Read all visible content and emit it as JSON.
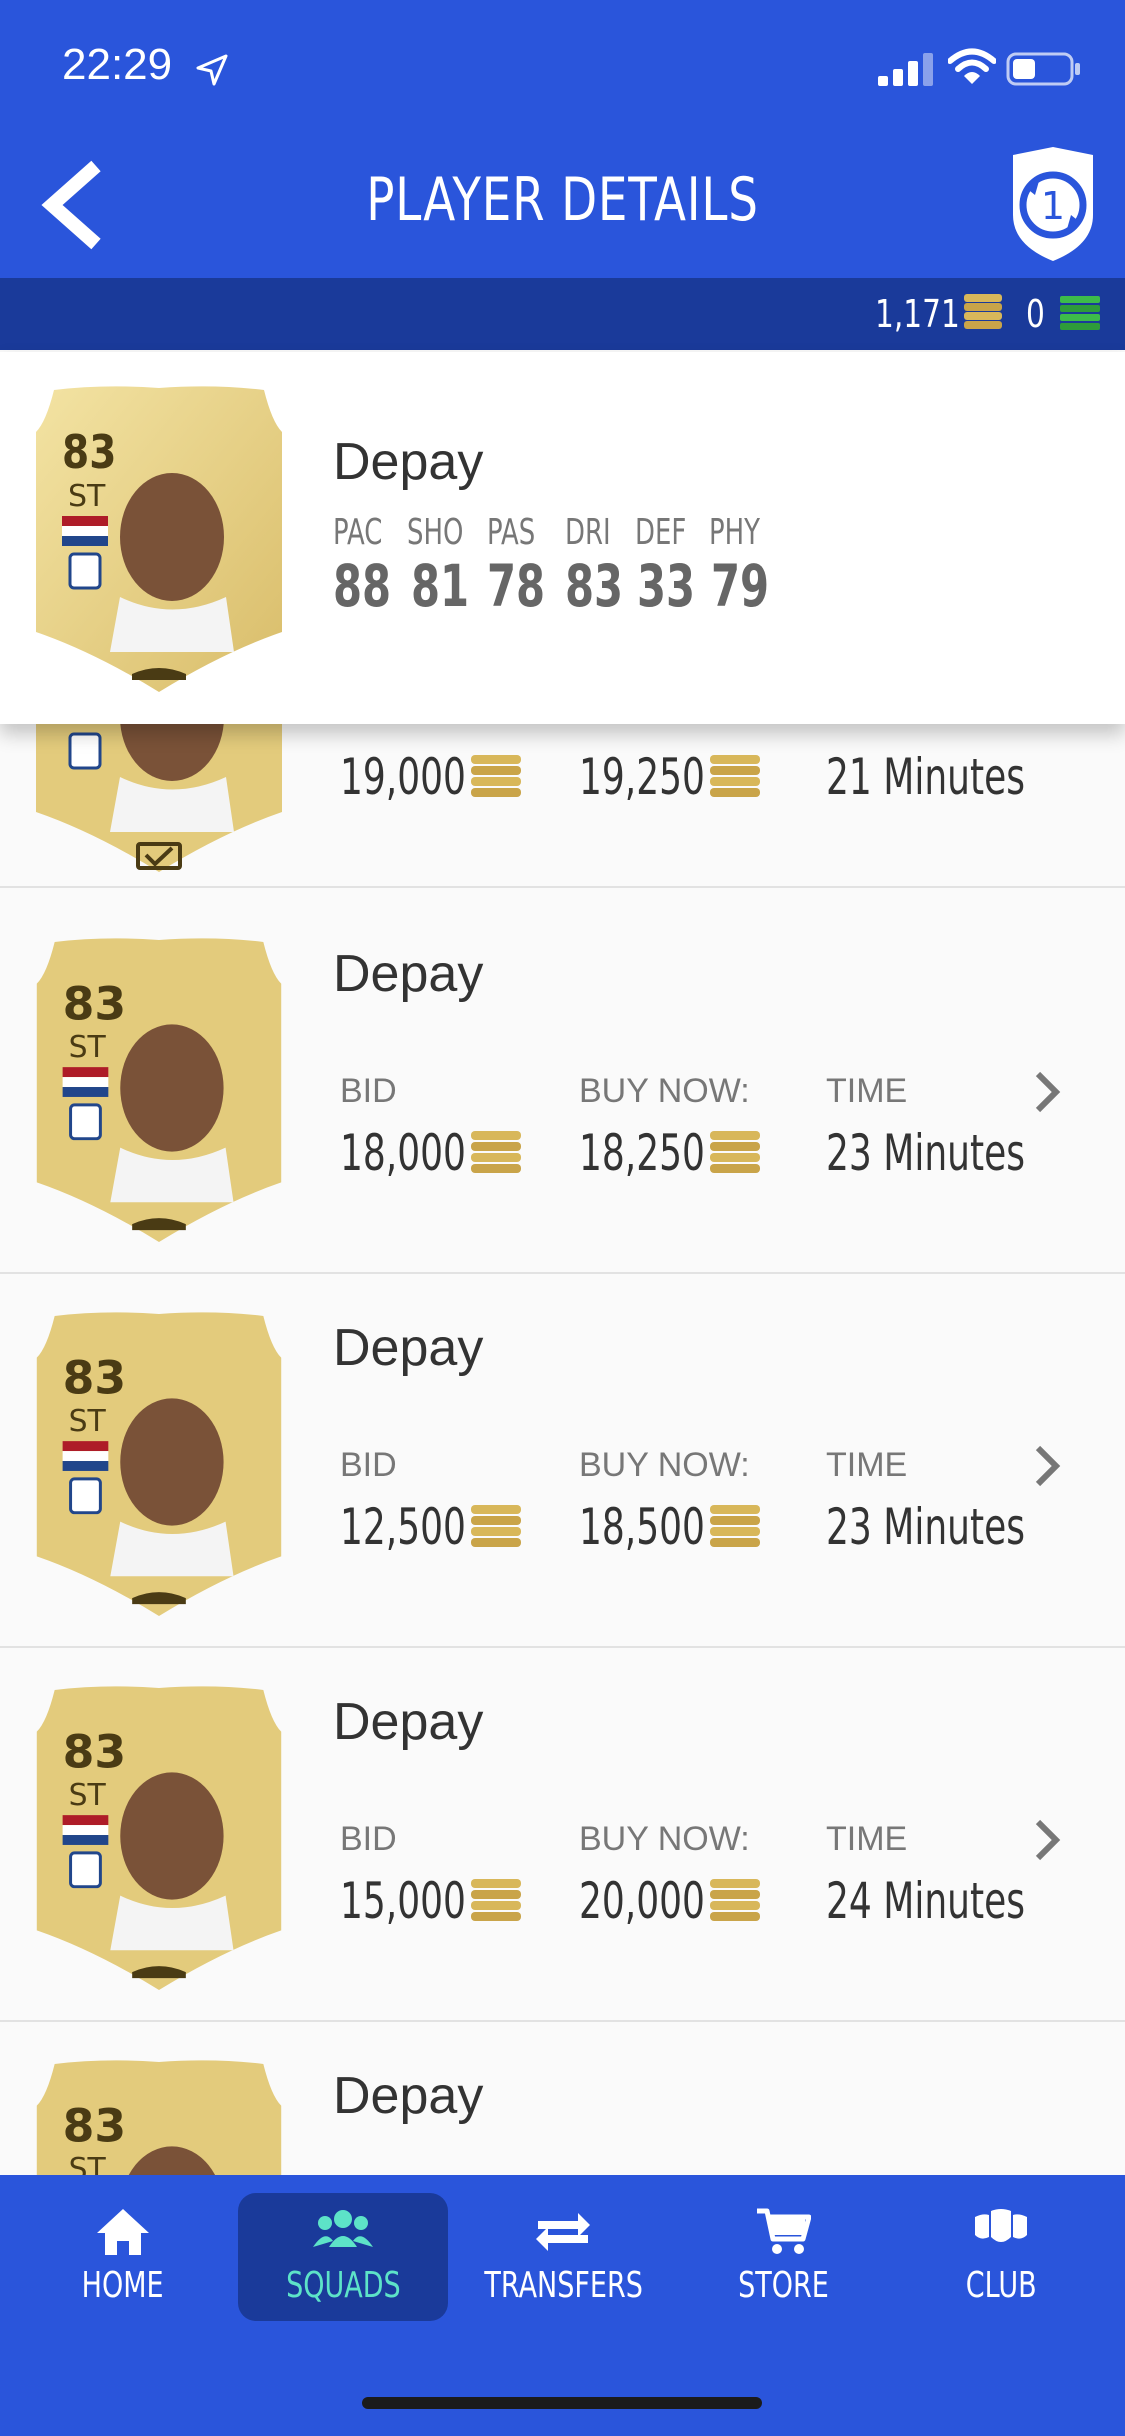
{
  "status_bar": {
    "time": "22:29"
  },
  "nav": {
    "title": "PLAYER DETAILS"
  },
  "currency": {
    "coins": "1,171",
    "points": "0"
  },
  "player": {
    "rating": "83",
    "position": "ST",
    "name": "Depay",
    "stats": [
      {
        "label": "PAC",
        "value": "88"
      },
      {
        "label": "SHO",
        "value": "81"
      },
      {
        "label": "PAS",
        "value": "78"
      },
      {
        "label": "DRI",
        "value": "83"
      },
      {
        "label": "DEF",
        "value": "33"
      },
      {
        "label": "PHY",
        "value": "79"
      }
    ]
  },
  "labels": {
    "bid": "BID",
    "buy_now": "BUY NOW:",
    "time": "TIME"
  },
  "listings": [
    {
      "name": "Depay",
      "bid": "19,000",
      "buy_now": "19,250",
      "time": "21 Minutes"
    },
    {
      "name": "Depay",
      "bid": "18,000",
      "buy_now": "18,250",
      "time": "23 Minutes"
    },
    {
      "name": "Depay",
      "bid": "12,500",
      "buy_now": "18,500",
      "time": "23 Minutes"
    },
    {
      "name": "Depay",
      "bid": "15,000",
      "buy_now": "20,000",
      "time": "24 Minutes"
    },
    {
      "name": "Depay"
    }
  ],
  "tabs": [
    {
      "label": "HOME",
      "icon": "home-icon"
    },
    {
      "label": "SQUADS",
      "icon": "squads-icon",
      "active": true
    },
    {
      "label": "TRANSFERS",
      "icon": "transfers-icon"
    },
    {
      "label": "STORE",
      "icon": "store-icon"
    },
    {
      "label": "CLUB",
      "icon": "club-icon"
    }
  ],
  "colors": {
    "header": "#2a55db",
    "currency_bar": "#1a3a9a",
    "active_tab": "#5de3c8",
    "card_gold": "#e3cb7c"
  }
}
